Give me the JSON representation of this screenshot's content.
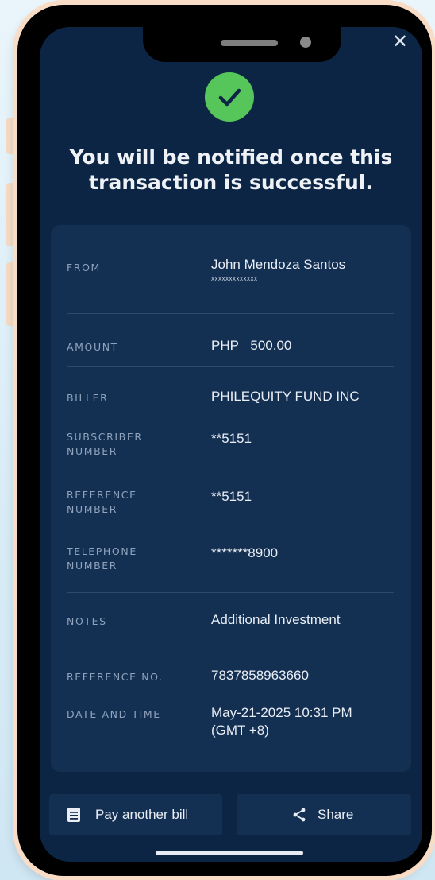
{
  "header": {
    "close_glyph": "✕",
    "success_icon": "check-icon",
    "message": "You will be notified once this transaction is successful."
  },
  "details": {
    "from": {
      "label": "FROM",
      "name": "John Mendoza Santos",
      "account": "xxxxxxxxxxxxx"
    },
    "amount": {
      "label": "AMOUNT",
      "currency": "PHP",
      "value": "500.00"
    },
    "biller": {
      "label": "BILLER",
      "value": "PHILEQUITY FUND INC"
    },
    "subscriber_number": {
      "label_1": "SUBSCRIBER",
      "label_2": "NUMBER",
      "value": "**5151"
    },
    "reference_number": {
      "label_1": "REFERENCE",
      "label_2": "NUMBER",
      "value": "**5151"
    },
    "telephone_number": {
      "label_1": "TELEPHONE",
      "label_2": "NUMBER",
      "value": "*******8900"
    },
    "notes": {
      "label": "NOTES",
      "value": "Additional Investment"
    },
    "reference_no": {
      "label": "REFERENCE NO.",
      "value": "7837858963660"
    },
    "date_time": {
      "label": "DATE AND TIME",
      "value_1": "May-21-2025 10:31 PM",
      "value_2": "(GMT +8)"
    }
  },
  "actions": {
    "pay_another": {
      "label": "Pay another bill",
      "icon": "receipt-icon"
    },
    "share": {
      "label": "Share",
      "icon": "share-icon"
    }
  },
  "colors": {
    "screen_bg": "#0c2544",
    "card_bg": "#132f52",
    "success_green": "#56c65a",
    "label_text": "#8fa3bd",
    "value_text": "#e9eef5"
  }
}
